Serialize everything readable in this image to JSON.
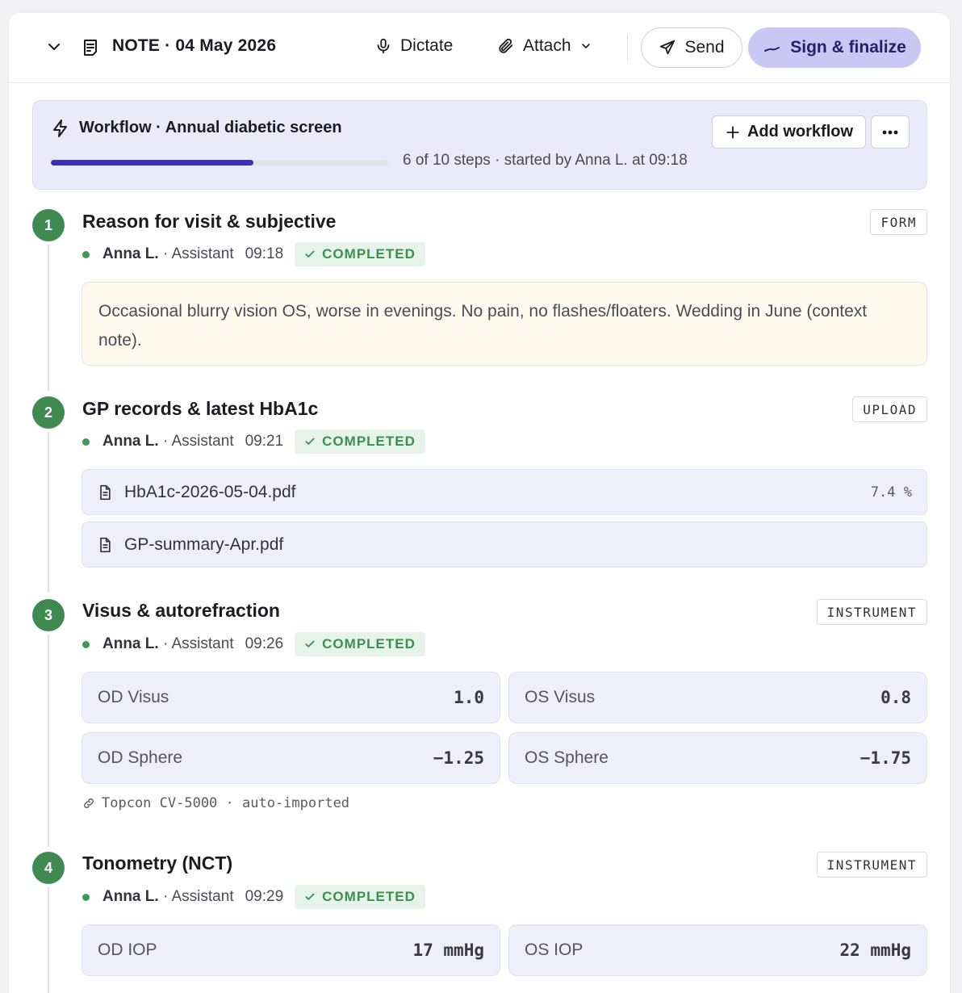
{
  "header": {
    "note_title": "NOTE · 04 May 2026",
    "dictate_label": "Dictate",
    "attach_label": "Attach",
    "send_label": "Send",
    "sign_label": "Sign & finalize"
  },
  "workflow": {
    "title": "Workflow · Annual diabetic screen",
    "steps_done": 6,
    "steps_total": 10,
    "meta": "6 of 10 steps · started by Anna L. at 09:18",
    "add_label": "Add workflow"
  },
  "steps": [
    {
      "number": "1",
      "title": "Reason for visit & subjective",
      "tag": "FORM",
      "who": "Anna L.",
      "role": "· Assistant",
      "time": "09:18",
      "status": "COMPLETED",
      "note": "Occasional blurry vision OS, worse in evenings. No pain, no flashes/floaters. Wedding in June (context note)."
    },
    {
      "number": "2",
      "title": "GP records & latest HbA1c",
      "tag": "UPLOAD",
      "who": "Anna L.",
      "role": "· Assistant",
      "time": "09:21",
      "status": "COMPLETED",
      "files": [
        {
          "name": "HbA1c-2026-05-04.pdf",
          "value": "7.4 %"
        },
        {
          "name": "GP-summary-Apr.pdf",
          "value": ""
        }
      ]
    },
    {
      "number": "3",
      "title": "Visus & autorefraction",
      "tag": "INSTRUMENT",
      "who": "Anna L.",
      "role": "· Assistant",
      "time": "09:26",
      "status": "COMPLETED",
      "measurements": [
        {
          "label": "OD Visus",
          "value": "1.0"
        },
        {
          "label": "OS Visus",
          "value": "0.8"
        },
        {
          "label": "OD Sphere",
          "value": "−1.25"
        },
        {
          "label": "OS Sphere",
          "value": "−1.75"
        }
      ],
      "source": "Topcon CV-5000 · auto-imported"
    },
    {
      "number": "4",
      "title": "Tonometry (NCT)",
      "tag": "INSTRUMENT",
      "who": "Anna L.",
      "role": "· Assistant",
      "time": "09:29",
      "status": "COMPLETED",
      "measurements": [
        {
          "label": "OD IOP",
          "value": "17 mmHg"
        },
        {
          "label": "OS IOP",
          "value": "22 mmHg"
        }
      ]
    }
  ],
  "colors": {
    "accent": "#3d2fb0",
    "sign_bg": "#c9c7f4",
    "completed": "#3c8f51",
    "step_circle": "#3f8a50"
  }
}
